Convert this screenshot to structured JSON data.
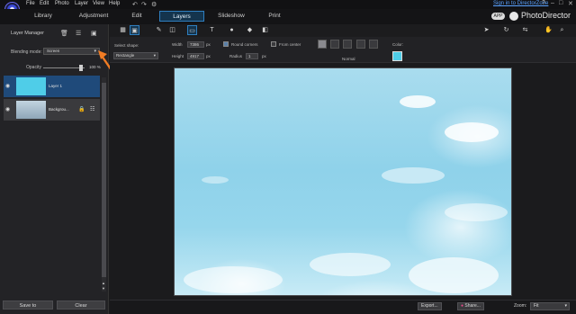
{
  "menu": [
    "File",
    "Edit",
    "Photo",
    "Layer",
    "View",
    "Help"
  ],
  "signin": "Sign in to DirectorZone",
  "window_controls": [
    "?",
    "–",
    "□",
    "✕"
  ],
  "modes": [
    {
      "label": "Library"
    },
    {
      "label": "Adjustment"
    },
    {
      "label": "Edit"
    },
    {
      "label": "Layers"
    },
    {
      "label": "Slideshow"
    },
    {
      "label": "Print"
    }
  ],
  "brand": {
    "badge": "APP",
    "name": "PhotoDirector"
  },
  "layer_manager": {
    "title": "Layer Manager",
    "blending_label": "Blending mode:",
    "blending_value": "Screen",
    "opacity_label": "Opacity",
    "opacity_value": "100 %",
    "opacity_fraction": 1.0,
    "layers": [
      {
        "name": "Layer 1",
        "selected": true,
        "color": "#4fcde8"
      },
      {
        "name": "Backgrou...",
        "selected": false,
        "color": "#aabccb"
      }
    ],
    "save_label": "Save to",
    "clear_label": "Clear"
  },
  "options": {
    "select_shape_label": "Select shape:",
    "shape_value": "Rectangle",
    "width_label": "Width",
    "width_value": "7386",
    "height_label": "Height",
    "height_value": "4917",
    "unit": "px",
    "round_corners_label": "Round corners",
    "round_corners_checked": true,
    "from_center_label": "From center",
    "from_center_checked": false,
    "radius_label": "Radius",
    "radius_value": "1",
    "mode_value": "Normal",
    "color_label": "Color:",
    "color_value": "#4fcde8"
  },
  "bottom": {
    "export_label": "Export...",
    "share_label": "Share...",
    "zoom_label": "Zoom:",
    "zoom_value": "Fit"
  },
  "colors": {
    "accent": "#2f7fc0",
    "annotation_arrow": "#f07c24"
  }
}
